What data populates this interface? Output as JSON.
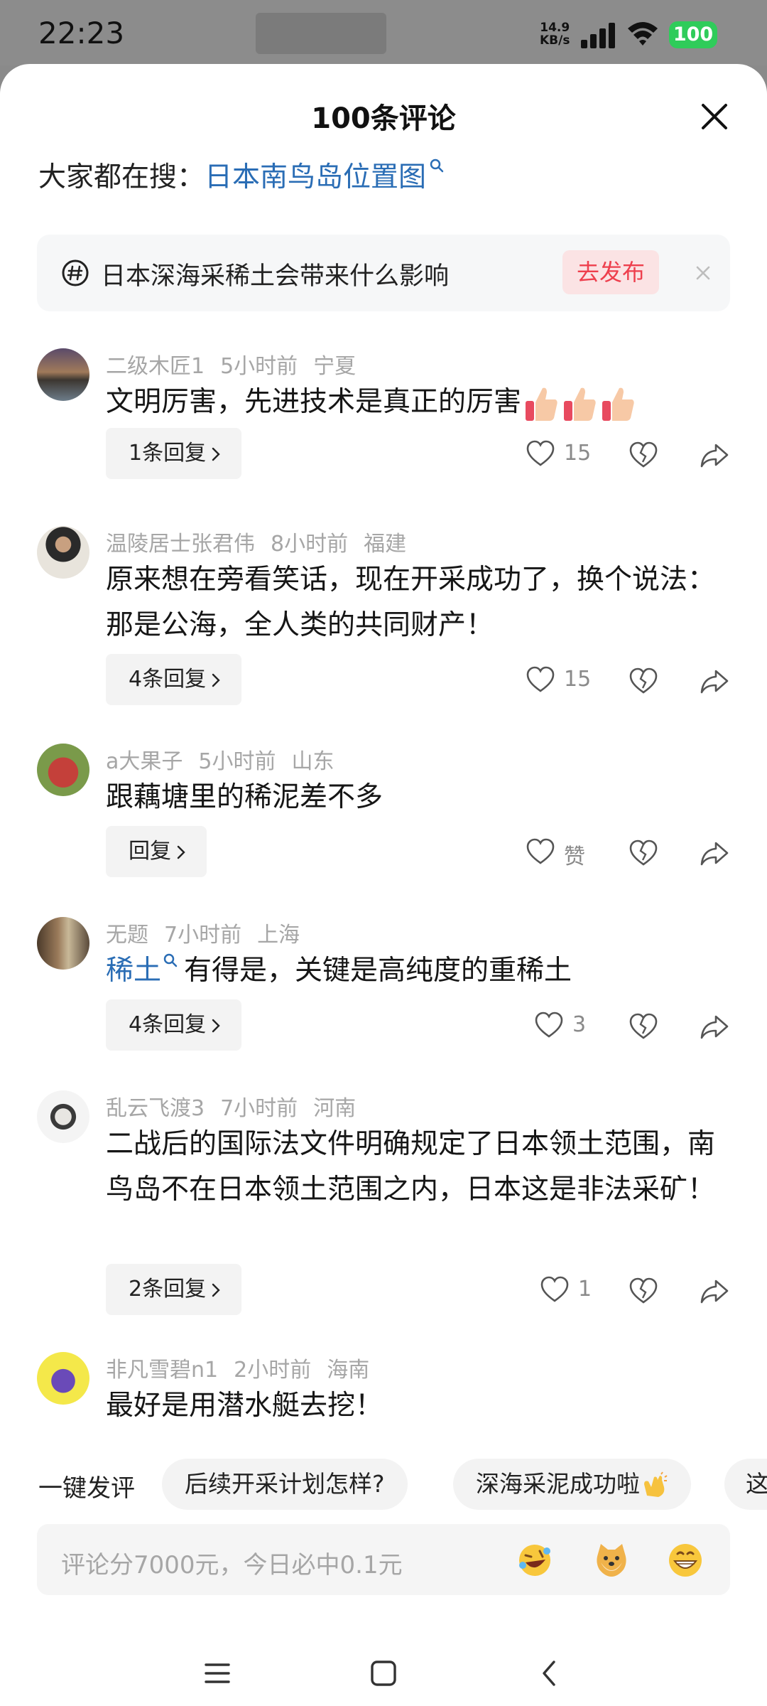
{
  "status_bar": {
    "time": "22:23",
    "net_speed_value": "14.9",
    "net_speed_unit": "KB/s",
    "battery": "100"
  },
  "sheet": {
    "title": "100条评论",
    "search_label": "大家都在搜：",
    "search_link": "日本南鸟岛位置图",
    "topic": {
      "text": "日本深海采稀土会带来什么影响",
      "button": "去发布"
    }
  },
  "comments": [
    {
      "user": "二级木匠1",
      "time": "5小时前",
      "region": "宁夏",
      "text": "文明厉害，先进技术是真正的厉害",
      "reply": "1条回复",
      "likes": "15"
    },
    {
      "user": "温陵居士张君伟",
      "time": "8小时前",
      "region": "福建",
      "text": "原来想在旁看笑话，现在开采成功了，换个说法：那是公海，全人类的共同财产！",
      "reply": "4条回复",
      "likes": "15"
    },
    {
      "user": "a大果子",
      "time": "5小时前",
      "region": "山东",
      "text": "跟藕塘里的稀泥差不多",
      "reply": "回复",
      "likes": "赞"
    },
    {
      "user": "无题",
      "time": "7小时前",
      "region": "上海",
      "link": "稀土",
      "text": "有得是，关键是高纯度的重稀土",
      "reply": "4条回复",
      "likes": "3"
    },
    {
      "user": "乱云飞渡3",
      "time": "7小时前",
      "region": "河南",
      "text": "二战后的国际法文件明确规定了日本领土范围，南鸟岛不在日本领土范围之内，日本这是非法采矿！",
      "reply": "2条回复",
      "likes": "1"
    },
    {
      "user": "非凡雪碧n1",
      "time": "2小时前",
      "region": "海南",
      "text": "最好是用潜水艇去挖！"
    }
  ],
  "quick_comment": {
    "label": "一键发评",
    "chips": [
      "后续开采计划怎样?",
      "深海采泥成功啦",
      "这"
    ]
  },
  "input": {
    "placeholder": "评论分7000元，今日必中0.1元"
  },
  "icons": {
    "close": "close-icon",
    "topic": "hashtag-icon",
    "like": "heart-icon",
    "dislike": "broken-heart-icon",
    "share": "share-icon",
    "thumbs_up": "thumbs-up-emoji",
    "clap": "clap-emoji",
    "emoji_laugh_cry": "rolling-laugh-emoji",
    "emoji_doge": "doge-emoji",
    "emoji_grin": "grin-emoji",
    "nav_menu": "menu-icon",
    "nav_home": "home-icon",
    "nav_back": "back-icon"
  },
  "colors": {
    "link": "#2a6db5",
    "accent_red": "#ee3f4d",
    "battery_green": "#2fcc5a"
  }
}
